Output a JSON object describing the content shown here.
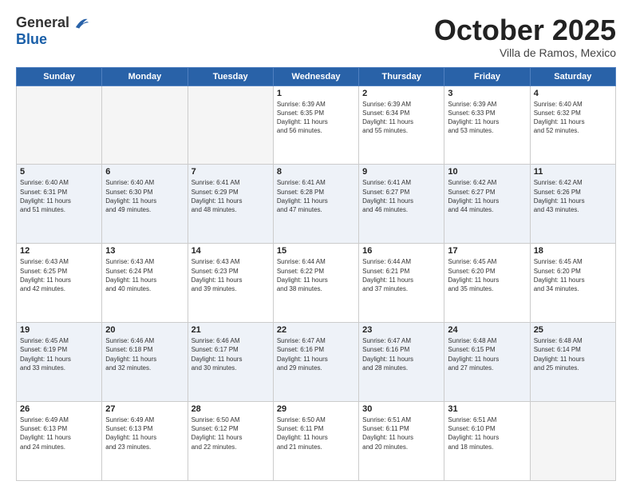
{
  "header": {
    "logo_general": "General",
    "logo_blue": "Blue",
    "month_title": "October 2025",
    "subtitle": "Villa de Ramos, Mexico"
  },
  "days_of_week": [
    "Sunday",
    "Monday",
    "Tuesday",
    "Wednesday",
    "Thursday",
    "Friday",
    "Saturday"
  ],
  "weeks": [
    [
      {
        "day": "",
        "info": ""
      },
      {
        "day": "",
        "info": ""
      },
      {
        "day": "",
        "info": ""
      },
      {
        "day": "1",
        "info": "Sunrise: 6:39 AM\nSunset: 6:35 PM\nDaylight: 11 hours\nand 56 minutes."
      },
      {
        "day": "2",
        "info": "Sunrise: 6:39 AM\nSunset: 6:34 PM\nDaylight: 11 hours\nand 55 minutes."
      },
      {
        "day": "3",
        "info": "Sunrise: 6:39 AM\nSunset: 6:33 PM\nDaylight: 11 hours\nand 53 minutes."
      },
      {
        "day": "4",
        "info": "Sunrise: 6:40 AM\nSunset: 6:32 PM\nDaylight: 11 hours\nand 52 minutes."
      }
    ],
    [
      {
        "day": "5",
        "info": "Sunrise: 6:40 AM\nSunset: 6:31 PM\nDaylight: 11 hours\nand 51 minutes."
      },
      {
        "day": "6",
        "info": "Sunrise: 6:40 AM\nSunset: 6:30 PM\nDaylight: 11 hours\nand 49 minutes."
      },
      {
        "day": "7",
        "info": "Sunrise: 6:41 AM\nSunset: 6:29 PM\nDaylight: 11 hours\nand 48 minutes."
      },
      {
        "day": "8",
        "info": "Sunrise: 6:41 AM\nSunset: 6:28 PM\nDaylight: 11 hours\nand 47 minutes."
      },
      {
        "day": "9",
        "info": "Sunrise: 6:41 AM\nSunset: 6:27 PM\nDaylight: 11 hours\nand 46 minutes."
      },
      {
        "day": "10",
        "info": "Sunrise: 6:42 AM\nSunset: 6:27 PM\nDaylight: 11 hours\nand 44 minutes."
      },
      {
        "day": "11",
        "info": "Sunrise: 6:42 AM\nSunset: 6:26 PM\nDaylight: 11 hours\nand 43 minutes."
      }
    ],
    [
      {
        "day": "12",
        "info": "Sunrise: 6:43 AM\nSunset: 6:25 PM\nDaylight: 11 hours\nand 42 minutes."
      },
      {
        "day": "13",
        "info": "Sunrise: 6:43 AM\nSunset: 6:24 PM\nDaylight: 11 hours\nand 40 minutes."
      },
      {
        "day": "14",
        "info": "Sunrise: 6:43 AM\nSunset: 6:23 PM\nDaylight: 11 hours\nand 39 minutes."
      },
      {
        "day": "15",
        "info": "Sunrise: 6:44 AM\nSunset: 6:22 PM\nDaylight: 11 hours\nand 38 minutes."
      },
      {
        "day": "16",
        "info": "Sunrise: 6:44 AM\nSunset: 6:21 PM\nDaylight: 11 hours\nand 37 minutes."
      },
      {
        "day": "17",
        "info": "Sunrise: 6:45 AM\nSunset: 6:20 PM\nDaylight: 11 hours\nand 35 minutes."
      },
      {
        "day": "18",
        "info": "Sunrise: 6:45 AM\nSunset: 6:20 PM\nDaylight: 11 hours\nand 34 minutes."
      }
    ],
    [
      {
        "day": "19",
        "info": "Sunrise: 6:45 AM\nSunset: 6:19 PM\nDaylight: 11 hours\nand 33 minutes."
      },
      {
        "day": "20",
        "info": "Sunrise: 6:46 AM\nSunset: 6:18 PM\nDaylight: 11 hours\nand 32 minutes."
      },
      {
        "day": "21",
        "info": "Sunrise: 6:46 AM\nSunset: 6:17 PM\nDaylight: 11 hours\nand 30 minutes."
      },
      {
        "day": "22",
        "info": "Sunrise: 6:47 AM\nSunset: 6:16 PM\nDaylight: 11 hours\nand 29 minutes."
      },
      {
        "day": "23",
        "info": "Sunrise: 6:47 AM\nSunset: 6:16 PM\nDaylight: 11 hours\nand 28 minutes."
      },
      {
        "day": "24",
        "info": "Sunrise: 6:48 AM\nSunset: 6:15 PM\nDaylight: 11 hours\nand 27 minutes."
      },
      {
        "day": "25",
        "info": "Sunrise: 6:48 AM\nSunset: 6:14 PM\nDaylight: 11 hours\nand 25 minutes."
      }
    ],
    [
      {
        "day": "26",
        "info": "Sunrise: 6:49 AM\nSunset: 6:13 PM\nDaylight: 11 hours\nand 24 minutes."
      },
      {
        "day": "27",
        "info": "Sunrise: 6:49 AM\nSunset: 6:13 PM\nDaylight: 11 hours\nand 23 minutes."
      },
      {
        "day": "28",
        "info": "Sunrise: 6:50 AM\nSunset: 6:12 PM\nDaylight: 11 hours\nand 22 minutes."
      },
      {
        "day": "29",
        "info": "Sunrise: 6:50 AM\nSunset: 6:11 PM\nDaylight: 11 hours\nand 21 minutes."
      },
      {
        "day": "30",
        "info": "Sunrise: 6:51 AM\nSunset: 6:11 PM\nDaylight: 11 hours\nand 20 minutes."
      },
      {
        "day": "31",
        "info": "Sunrise: 6:51 AM\nSunset: 6:10 PM\nDaylight: 11 hours\nand 18 minutes."
      },
      {
        "day": "",
        "info": ""
      }
    ]
  ]
}
